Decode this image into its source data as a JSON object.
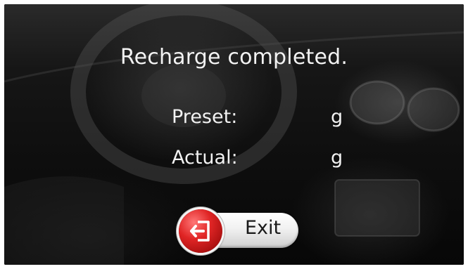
{
  "screen": {
    "title": "Recharge completed.",
    "preset_label": "Preset:",
    "preset_value": "g",
    "actual_label": "Actual:",
    "actual_value": "g"
  },
  "exit_button": {
    "label": "Exit",
    "icon": "exit-door-icon"
  },
  "colors": {
    "background": "#0a0a0a",
    "text": "#f2f2f2",
    "exit_icon_red": "#e02525",
    "exit_button_face": "#f1f1f1"
  }
}
